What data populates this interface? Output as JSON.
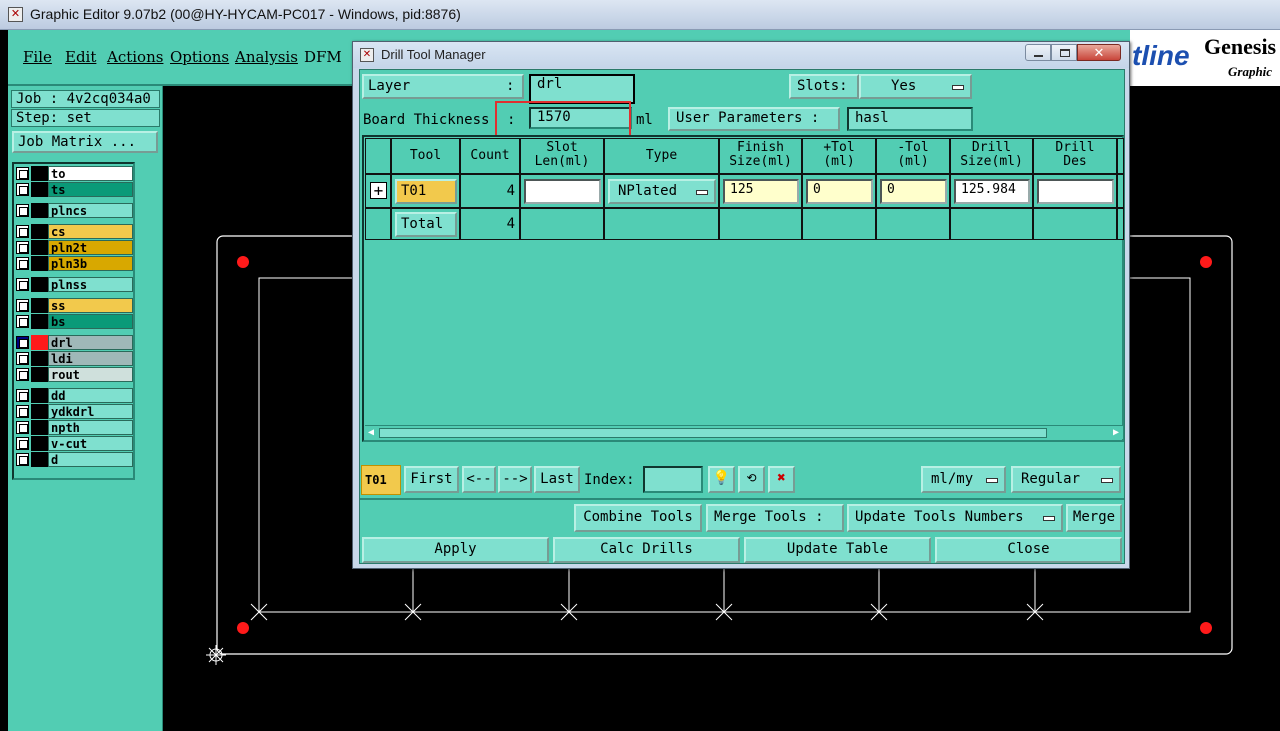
{
  "window_title": "Graphic Editor 9.07b2 (00@HY-HYCAM-PC017 - Windows, pid:8876)",
  "menu": [
    "File",
    "Edit",
    "Actions",
    "Options",
    "Analysis",
    "DFM"
  ],
  "logo": {
    "brand_suffix": "tline",
    "brand": "Genesis",
    "sub": "Graphic"
  },
  "job_panel": {
    "job": "Job : 4v2cq034a0",
    "step": "Step: set",
    "job_matrix": "Job Matrix ..."
  },
  "layers": [
    {
      "name": "to",
      "color": "#ffffff",
      "group": 0
    },
    {
      "name": "ts",
      "color": "#0a9a78",
      "group": 0
    },
    {
      "name": "plncs",
      "color": "#7fe0cf",
      "group": 1
    },
    {
      "name": "cs",
      "color": "#f2c94c",
      "group": 2
    },
    {
      "name": "pln2t",
      "color": "#d8a800",
      "group": 2
    },
    {
      "name": "pln3b",
      "color": "#d8a800",
      "group": 2
    },
    {
      "name": "plnss",
      "color": "#7fe0cf",
      "group": 3
    },
    {
      "name": "ss",
      "color": "#f2c94c",
      "group": 4
    },
    {
      "name": "bs",
      "color": "#0a9a78",
      "group": 4
    },
    {
      "name": "drl",
      "color": "#9fb8b8",
      "group": 5,
      "active": true
    },
    {
      "name": "ldi",
      "color": "#9fb8b8",
      "group": 5
    },
    {
      "name": "rout",
      "color": "#cfe0dc",
      "group": 5
    },
    {
      "name": "dd",
      "color": "#7fe0cf",
      "group": 6
    },
    {
      "name": "ydkdrl",
      "color": "#7fe0cf",
      "group": 6
    },
    {
      "name": "npth",
      "color": "#7fe0cf",
      "group": 6
    },
    {
      "name": "v-cut",
      "color": "#7fe0cf",
      "group": 6
    },
    {
      "name": "d",
      "color": "#7fe0cf",
      "group": 6
    }
  ],
  "dialog": {
    "title": "Drill Tool Manager",
    "layer_label": "Layer",
    "layer_colon": ":",
    "layer_value": "drl",
    "slots_label": "Slots:",
    "slots_value": "Yes",
    "board_thickness_label": "Board Thickness",
    "board_thickness_colon": ":",
    "board_thickness_value": "1570",
    "board_thickness_unit": "ml",
    "user_params_button": "User Parameters :",
    "user_params_value": "hasl",
    "table": {
      "headers": [
        "Tool",
        "Count",
        "Slot\nLen(ml)",
        "Type",
        "Finish\nSize(ml)",
        "+Tol\n(ml)",
        "-Tol\n(ml)",
        "Drill\nSize(ml)",
        "Drill\nDes"
      ],
      "rows": [
        {
          "tool": "T01",
          "count": "4",
          "slot_len": "",
          "type": "NPlated",
          "finish_size": "125",
          "plus_tol": "0",
          "minus_tol": "0",
          "drill_size": "125.984",
          "drill_des": ""
        }
      ],
      "total_label": "Total",
      "total_count": "4"
    },
    "nav": {
      "current_tool": "T01",
      "first": "First",
      "prev": "<--",
      "next": "-->",
      "last": "Last",
      "index_label": "Index:",
      "index_value": "",
      "units": "ml/my",
      "mode": "Regular"
    },
    "actions": {
      "combine": "Combine Tools",
      "merge_tools": "Merge Tools :",
      "update_numbers": "Update Tools Numbers",
      "merge": "Merge",
      "apply": "Apply",
      "calc": "Calc Drills",
      "update_table": "Update Table",
      "close": "Close"
    }
  },
  "colors": {
    "panel": "#52cdb3",
    "field": "#7fe0cf",
    "highlight": "#e03030",
    "tool_button": "#f2c94c"
  }
}
